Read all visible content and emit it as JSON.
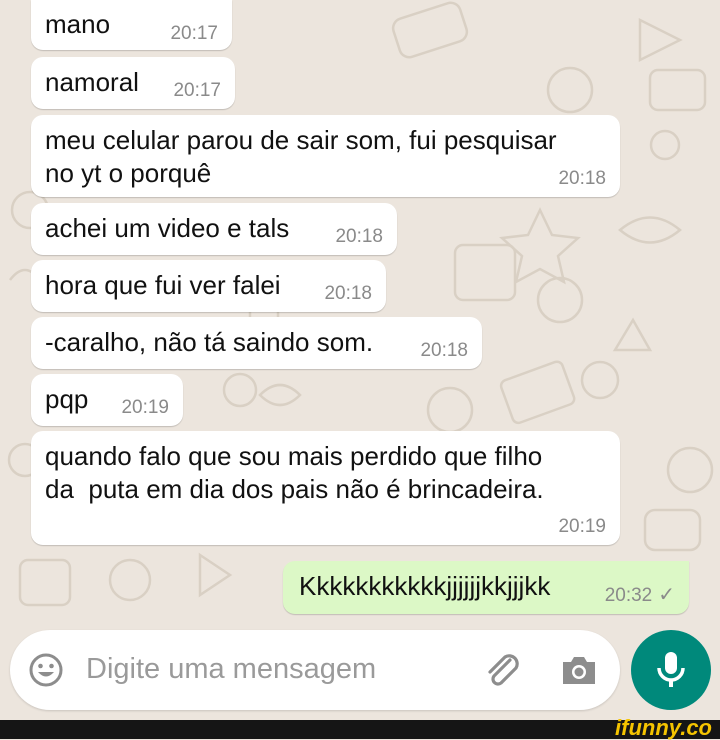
{
  "messages": [
    {
      "text": "mano",
      "time": "20:17"
    },
    {
      "text": "namoral",
      "time": "20:17"
    },
    {
      "text": "meu celular parou de sair som, fui pesquisar\nno yt o porquê",
      "time": "20:18"
    },
    {
      "text": "achei um video e tals",
      "time": "20:18"
    },
    {
      "text": "hora que fui ver falei",
      "time": "20:18"
    },
    {
      "text": "-caralho, não tá saindo som.",
      "time": "20:18"
    },
    {
      "text": "pqp",
      "time": "20:19"
    },
    {
      "text": "quando falo que sou mais perdido que filho\nda  puta em dia dos pais não é brincadeira.",
      "time": "20:19"
    },
    {
      "text": "Kkkkkkkkkkkjjjjjjkkjjjkk",
      "time": "20:32",
      "status": "✓"
    }
  ],
  "composer": {
    "placeholder": "Digite uma mensagem",
    "icons": [
      "emoji-icon",
      "attach-icon",
      "camera-icon",
      "microphone-icon"
    ]
  },
  "watermark": "ifunny.co",
  "colors": {
    "background": "#ece5dd",
    "incoming": "#ffffff",
    "outgoing": "#dcf8c6",
    "accent": "#00897b",
    "brand": "#f5c400"
  }
}
